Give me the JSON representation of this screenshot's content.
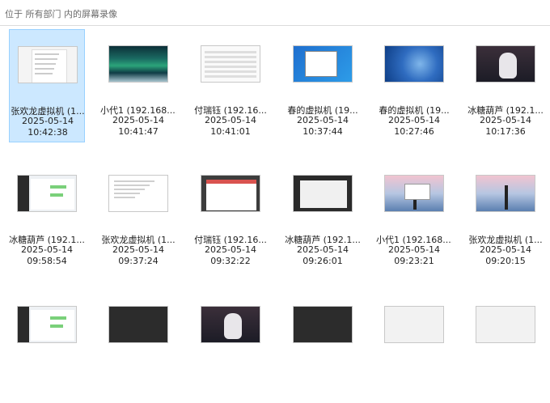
{
  "breadcrumb": "位于 所有部门 内的屏幕录像",
  "files": [
    {
      "name": "张欢龙虚拟机 (1...",
      "date": "2025-05-14",
      "time": "10:42:38",
      "thumb": "doc",
      "selected": true
    },
    {
      "name": "小代1 (192.168....",
      "date": "2025-05-14",
      "time": "10:41:47",
      "thumb": "aurora",
      "selected": false
    },
    {
      "name": "付瑞钰 (192.16...",
      "date": "2025-05-14",
      "time": "10:41:01",
      "thumb": "form",
      "selected": false
    },
    {
      "name": "春的虚拟机 (19...",
      "date": "2025-05-14",
      "time": "10:37:44",
      "thumb": "desk-blue",
      "selected": false
    },
    {
      "name": "春的虚拟机 (19...",
      "date": "2025-05-14",
      "time": "10:27:46",
      "thumb": "desk-win11",
      "selected": false
    },
    {
      "name": "冰糖葫芦 (192.1...",
      "date": "2025-05-14",
      "time": "10:17:36",
      "thumb": "cat",
      "selected": false
    },
    {
      "name": "冰糖葫芦 (192.1...",
      "date": "2025-05-14",
      "time": "09:58:54",
      "thumb": "chat",
      "selected": false
    },
    {
      "name": "张欢龙虚拟机 (1...",
      "date": "2025-05-14",
      "time": "09:37:24",
      "thumb": "blankdoc",
      "selected": false
    },
    {
      "name": "付瑞钰 (192.16...",
      "date": "2025-05-14",
      "time": "09:32:22",
      "thumb": "browser",
      "selected": false
    },
    {
      "name": "冰糖葫芦 (192.1...",
      "date": "2025-05-14",
      "time": "09:26:01",
      "thumb": "winapp",
      "selected": false
    },
    {
      "name": "小代1 (192.168....",
      "date": "2025-05-14",
      "time": "09:23:21",
      "thumb": "pier-dialog",
      "selected": false
    },
    {
      "name": "张欢龙虚拟机 (1...",
      "date": "2025-05-14",
      "time": "09:20:15",
      "thumb": "pier",
      "selected": false
    },
    {
      "name": "",
      "date": "",
      "time": "",
      "thumb": "chat",
      "selected": false
    },
    {
      "name": "",
      "date": "",
      "time": "",
      "thumb": "dark",
      "selected": false
    },
    {
      "name": "",
      "date": "",
      "time": "",
      "thumb": "cat",
      "selected": false
    },
    {
      "name": "",
      "date": "",
      "time": "",
      "thumb": "dark",
      "selected": false
    },
    {
      "name": "",
      "date": "",
      "time": "",
      "thumb": "light",
      "selected": false
    },
    {
      "name": "",
      "date": "",
      "time": "",
      "thumb": "light",
      "selected": false
    }
  ],
  "colors": {
    "selection_bg": "#cce8ff",
    "selection_border": "#99d1ff",
    "header_text": "#6b6b6b"
  }
}
